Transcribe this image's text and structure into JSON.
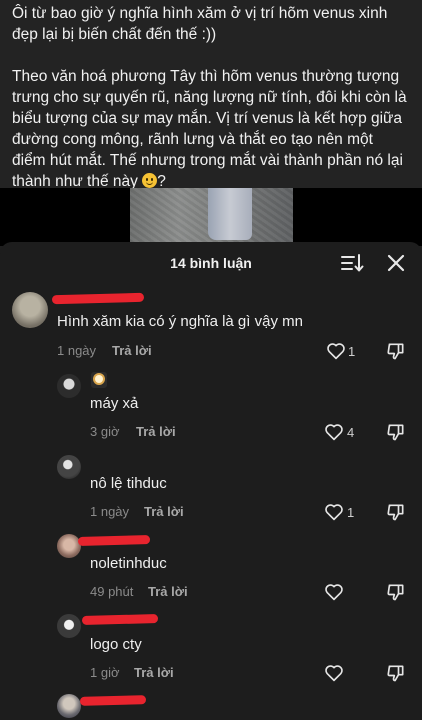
{
  "caption": {
    "paragraph1": "Ôi từ bao giờ ý nghĩa hình xăm ở vị trí hõm venus xinh đẹp lại bị biến chất đến thế :))",
    "paragraph2": "Theo văn hoá phương Tây thì hõm venus thường tượng trưng cho sự quyến rũ, năng lượng nữ tính, đôi khi còn là biểu tượng của sự may mắn. Vị trí venus là kết hợp giữa đường cong mông, rãnh lưng và thắt eo tạo nên một điểm hút mắt. Thế nhưng trong mắt vài thành phần nó lại thành như thế này",
    "paragraph2_end": "?",
    "emoji": "smiling-face-emoji"
  },
  "sheet": {
    "title": "14 bình luận",
    "sort_icon": "sort-icon",
    "close_icon": "close-icon"
  },
  "comments": [
    {
      "text": "Hình xăm kia có ý nghĩa là gì vậy mn",
      "time": "1 ngày",
      "reply_label": "Trả lời",
      "likes": "1"
    },
    {
      "text": "máy xả",
      "time": "3 giờ",
      "reply_label": "Trả lời",
      "likes": "4"
    },
    {
      "text": "nô lệ tihduc",
      "time": "1 ngày",
      "reply_label": "Trả lời",
      "likes": "1"
    },
    {
      "text": "noletinhduc",
      "time": "49 phút",
      "reply_label": "Trả lời",
      "likes": ""
    },
    {
      "text": "logo cty",
      "time": "1 giờ",
      "reply_label": "Trả lời",
      "likes": ""
    }
  ],
  "colors": {
    "background": "#1e1e1e",
    "redaction": "#e8242e",
    "text": "#efefef",
    "muted": "#8b8b8b"
  }
}
